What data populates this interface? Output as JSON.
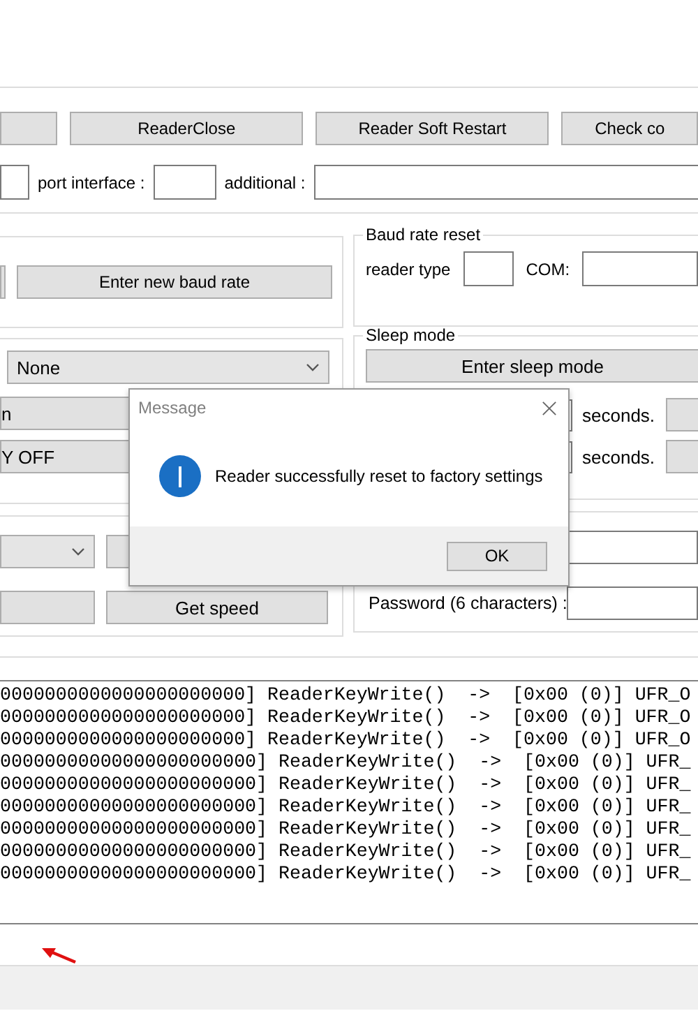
{
  "toolbar_buttons": [
    "ReaderClose",
    "Reader Soft Restart",
    "Check co"
  ],
  "connection": {
    "port_interface_label": "port interface :",
    "additional_label": "additional :"
  },
  "baud_rate": {
    "button": "Enter new baud rate"
  },
  "baud_rate_reset": {
    "title": "Baud rate reset",
    "reader_type_label": "reader type",
    "com_label": "COM:"
  },
  "left_panel": {
    "dropdown": "None",
    "buttons": [
      "n",
      "Y OFF"
    ],
    "get_speed_button": "Get speed"
  },
  "sleep_mode": {
    "title": "Sleep mode",
    "button": "Enter sleep mode",
    "rows": [
      "seconds.",
      "seconds."
    ]
  },
  "password_label": "Password (6 characters) :",
  "log_lines": [
    "0000000000000000000000] ReaderKeyWrite()  ->  [0x00 (0)] UFR_O",
    "0000000000000000000000] ReaderKeyWrite()  ->  [0x00 (0)] UFR_O",
    "0000000000000000000000] ReaderKeyWrite()  ->  [0x00 (0)] UFR_O",
    "00000000000000000000000] ReaderKeyWrite()  ->  [0x00 (0)] UFR_",
    "00000000000000000000000] ReaderKeyWrite()  ->  [0x00 (0)] UFR_",
    "00000000000000000000000] ReaderKeyWrite()  ->  [0x00 (0)] UFR_",
    "00000000000000000000000] ReaderKeyWrite()  ->  [0x00 (0)] UFR_",
    "00000000000000000000000] ReaderKeyWrite()  ->  [0x00 (0)] UFR_",
    "00000000000000000000000] ReaderKeyWrite()  ->  [0x00 (0)] UFR_"
  ],
  "dialog": {
    "title": "Message",
    "message": "Reader successfully reset to factory settings",
    "ok_button": "OK"
  }
}
